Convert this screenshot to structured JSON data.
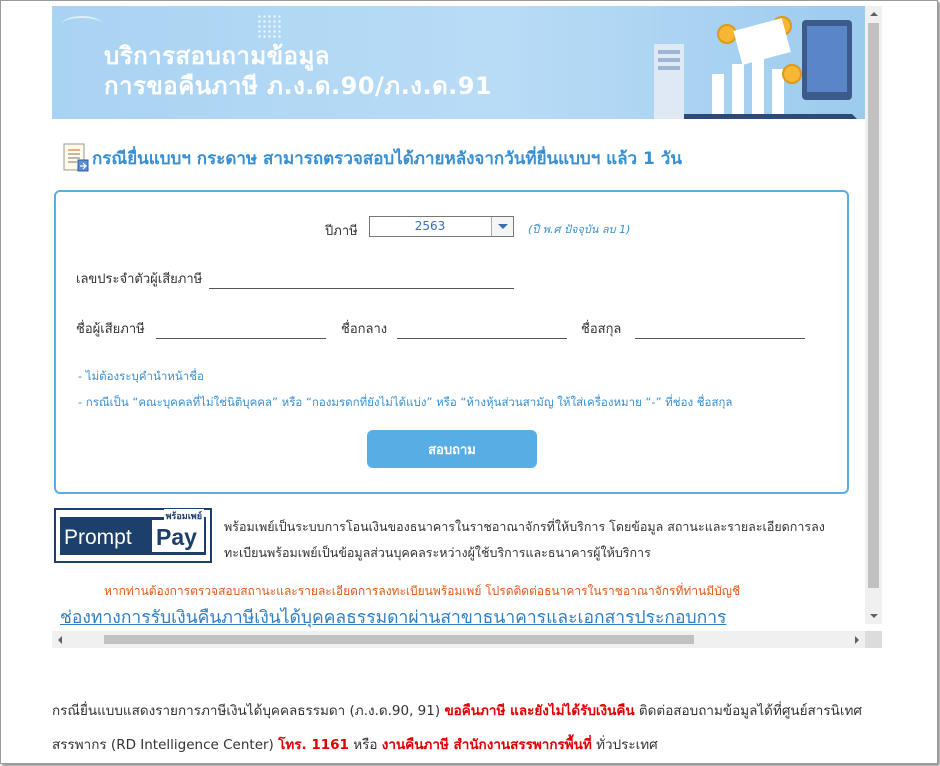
{
  "banner": {
    "title_line1": "บริการสอบถามข้อมูล",
    "title_line2": "การขอคืนภาษี ภ.ง.ด.90/ภ.ง.ด.91"
  },
  "heading": {
    "text": "กรณียื่นแบบฯ กระดาษ สามารถตรวจสอบได้ภายหลังจากวันที่ยื่นแบบฯ แล้ว 1 วัน",
    "icon": "document-icon"
  },
  "form": {
    "tax_year_label": "ปีภาษี",
    "tax_year_value": "2563",
    "tax_year_hint": "(ปี พ.ศ ปัจจุบัน ลบ 1)",
    "taxpayer_id_label": "เลขประจำตัวผู้เสียภาษี",
    "taxpayer_id_value": "",
    "first_name_label": "ชื่อผู้เสียภาษี",
    "first_name_value": "",
    "middle_name_label": "ชื่อกลาง",
    "middle_name_value": "",
    "last_name_label": "ชื่อสกุล",
    "last_name_value": "",
    "note1": "- ไม่ต้องระบุคำนำหน้าชื่อ",
    "note2": "- กรณีเป็น “คณะบุคคลที่ไม่ใช่นิติบุคคล” หรือ “กองมรดกที่ยังไม่ได้แบ่ง” หรือ “ห้างหุ้นส่วนสามัญ ให้ใส่เครื่องหมาย “-” ที่ช่อง ชื่อสกุล",
    "submit_label": "สอบถาม"
  },
  "promptpay": {
    "logo_thai": "พร้อมเพย์",
    "logo_prompt": "Prompt",
    "logo_pay": "Pay",
    "text": "พร้อมเพย์เป็นระบบการโอนเงินของธนาคารในราชอาณาจักรที่ให้บริการ โดยข้อมูล สถานะและรายละเอียดการลงทะเบียนพร้อมเพย์เป็นข้อมูลส่วนบุคคลระหว่างผู้ใช้บริการและธนาคารผู้ให้บริการ",
    "warning": "หากท่านต้องการตรวจสอบสถานะและรายละเอียดการลงทะเบียนพร้อมเพย์ โปรดติดต่อธนาคารในราชอาณาจักรที่ท่านมีบัญชี"
  },
  "link": {
    "text": "ช่องทางการรับเงินคืนภาษีเงินได้บุคคลธรรมดาผ่านสาขาธนาคารและเอกสารประกอบการ"
  },
  "footer": {
    "part1": "กรณียื่นแบบแสดงรายการภาษีเงินได้บุคคลธรรมดา (ภ.ง.ด.90, 91) ",
    "part2": "ขอคืนภาษี และยังไม่ได้รับเงินคืน",
    "part3": " ติดต่อสอบถามข้อมูลได้ที่ศูนย์สารนิเทศสรรพากร (RD Intelligence Center) ",
    "part4": "โทร. 1161",
    "part5": " หรือ ",
    "part6": "งานคืนภาษี สำนักงานสรรพากรพื้นที่",
    "part7": " ทั่วประเทศ"
  },
  "colors": {
    "accent": "#58aee4",
    "heading": "#3a8fd0",
    "warning": "#e05a1a",
    "alert_red": "#e00000",
    "promptpay_navy": "#1d3f6b"
  }
}
